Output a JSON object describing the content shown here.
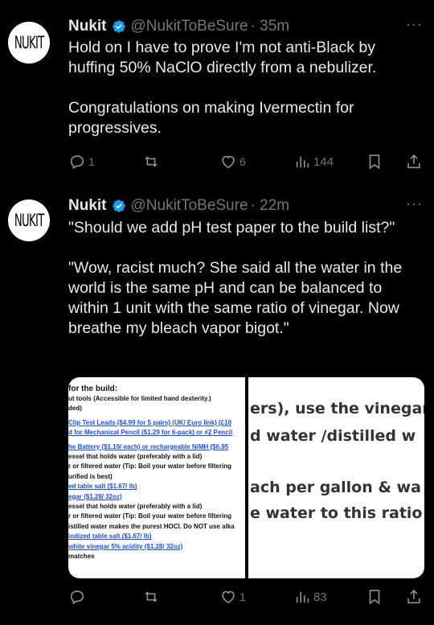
{
  "tweets": [
    {
      "avatar_text": "NUKIT",
      "name": "Nukit",
      "handle": "@NukitToBeSure",
      "time": "· 35m",
      "more": "···",
      "text": "Hold on I have to prove I'm not anti-Black by huffing 50% NaClO directly from a nebulizer.\n\nCongratulations on making Ivermectin for progressives.",
      "replies": "1",
      "retweets": "",
      "likes": "6",
      "views": "144"
    },
    {
      "avatar_text": "NUKIT",
      "name": "Nukit",
      "handle": "@NukitToBeSure",
      "time": "· 22m",
      "more": "···",
      "text": "\"Should we add pH test paper to the build list?\"\n\n\"Wow, racist much? She said all the water in the world is the same pH and can be balanced to within 1 unit with the same ratio of vinegar. Now breathe my bleach vapor bigot.\"",
      "replies": "",
      "retweets": "",
      "likes": "1",
      "views": "83"
    }
  ],
  "media": {
    "left_lines": [
      {
        "text": "for the build:",
        "link": false,
        "bold": true
      },
      {
        "text": "ut tools (Accessible for limited hand dexterity.)",
        "link": false,
        "bold": true
      },
      {
        "text": "ded)",
        "link": false,
        "bold": true
      },
      {
        "text": "",
        "link": false,
        "bold": false
      },
      {
        "text": "Clip Test Leads ($4.99 for 5 pairs) (UK/ Euro link) (£10",
        "link": true,
        "bold": true
      },
      {
        "text": "d for Mechanical Pencil ($1.29 for 6-pack) or #2 Pencil",
        "link": true,
        "bold": true
      },
      {
        "text": "",
        "link": false,
        "bold": false
      },
      {
        "text": "he Battery ($1.19/ each) or rechargeable NiMH ($6.95",
        "link": true,
        "bold": true
      },
      {
        "text": "essel that holds water (preferably with a lid)",
        "link": false,
        "bold": true
      },
      {
        "text": "r or filtered water (Tip: Boil your water before filtering",
        "link": false,
        "bold": true
      },
      {
        "text": "urified is best)",
        "link": false,
        "bold": true
      },
      {
        "text": "ed table salt ($1.67/ lb)",
        "link": true,
        "bold": true
      },
      {
        "text": "egar ($1.28/ 32oz)",
        "link": true,
        "bold": true
      },
      {
        "text": "essel that holds water (preferably with a lid)",
        "link": false,
        "bold": true
      },
      {
        "text": "r or filtered water (Tip: Boil your water before filtering",
        "link": false,
        "bold": true
      },
      {
        "text": "istilled water makes the purest HOCl. Do NOT use alka",
        "link": false,
        "bold": true
      },
      {
        "text": "iodized table salt ($1.67/ lb)",
        "link": true,
        "bold": true
      },
      {
        "text": "white vinegar 5% acidity ($1.28/ 32oz)",
        "link": true,
        "bold": true
      },
      {
        "text": "matches",
        "link": false,
        "bold": true
      }
    ],
    "right_lines": [
      "ers), use the vinegar",
      "d water /distilled w",
      "ach per gallon & wa",
      "e water to this ratio"
    ]
  }
}
